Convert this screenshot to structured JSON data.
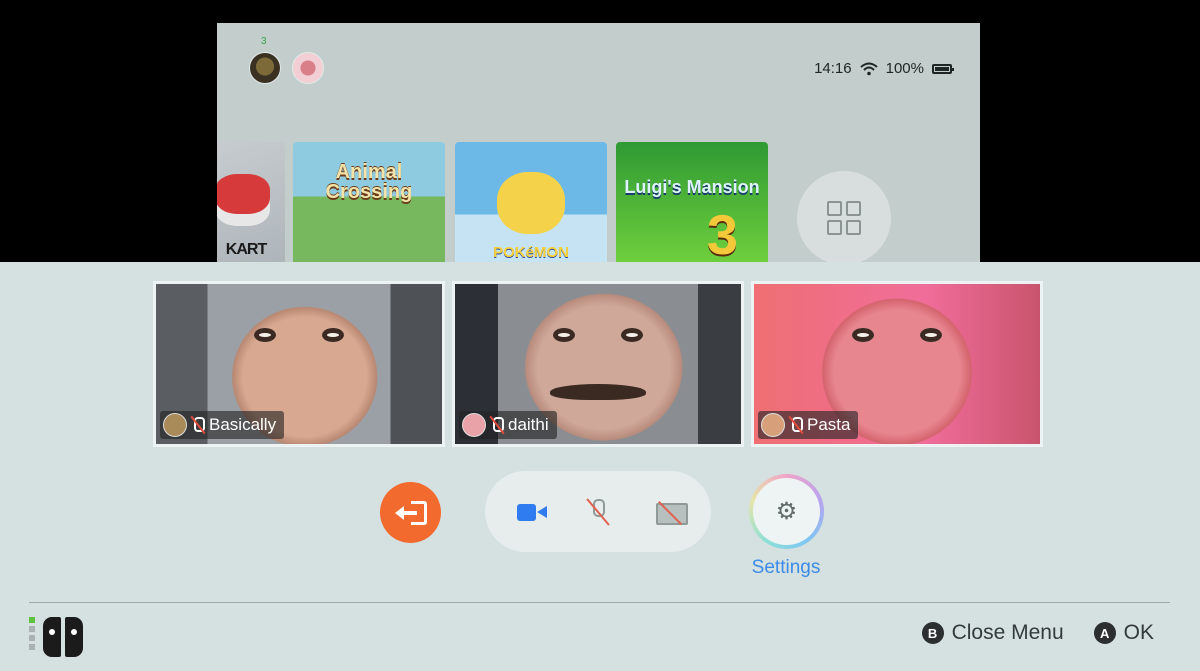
{
  "home": {
    "online_count": "3",
    "clock": "14:16",
    "battery": "100%",
    "games": [
      {
        "name": "KART"
      },
      {
        "name": "Animal Crossing"
      },
      {
        "name": "POKéMON"
      },
      {
        "name": "Luigi's Mansion",
        "badge": "3"
      }
    ]
  },
  "call": {
    "participants": [
      {
        "name": "Basically",
        "mic": "muted"
      },
      {
        "name": "daithi",
        "mic": "muted"
      },
      {
        "name": "Pasta",
        "mic": "muted"
      }
    ],
    "settings_label": "Settings"
  },
  "footer": {
    "hints": [
      {
        "button": "B",
        "label": "Close Menu"
      },
      {
        "button": "A",
        "label": "OK"
      }
    ]
  },
  "colors": {
    "leave": "#f26a2e",
    "accent": "#3c8be6",
    "camera": "#2f7cf0",
    "muted_slash": "#e06150"
  }
}
